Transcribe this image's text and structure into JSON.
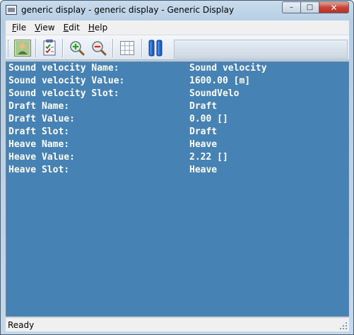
{
  "window": {
    "title": "generic display - generic display  - Generic Display",
    "minimize_glyph": "–",
    "maximize_glyph": "□",
    "close_glyph": "✕"
  },
  "menu": {
    "items": [
      {
        "label": "File",
        "accel": "F",
        "rest": "ile"
      },
      {
        "label": "View",
        "accel": "V",
        "rest": "iew"
      },
      {
        "label": "Edit",
        "accel": "E",
        "rest": "dit"
      },
      {
        "label": "Help",
        "accel": "H",
        "rest": "elp"
      }
    ]
  },
  "toolbar": {
    "icons": [
      "user-icon",
      "checklist-icon",
      "zoom-in-icon",
      "zoom-out-icon",
      "grid-icon",
      "pause-icon"
    ]
  },
  "content": {
    "background": "#4682b4",
    "text_color": "#ffffff",
    "rows": [
      {
        "label": "Sound velocity Name:",
        "value": "Sound velocity"
      },
      {
        "label": "Sound velocity Value:",
        "value": "1600.00 [m]"
      },
      {
        "label": "Sound velocity Slot:",
        "value": "SoundVelo"
      },
      {
        "label": "Draft Name:",
        "value": "Draft"
      },
      {
        "label": "Draft Value:",
        "value": "0.00 []"
      },
      {
        "label": "Draft Slot:",
        "value": "Draft"
      },
      {
        "label": "Heave Name:",
        "value": "Heave"
      },
      {
        "label": "Heave Value:",
        "value": "2.22 []"
      },
      {
        "label": "Heave Slot:",
        "value": "Heave"
      }
    ]
  },
  "status": {
    "text": "Ready"
  }
}
